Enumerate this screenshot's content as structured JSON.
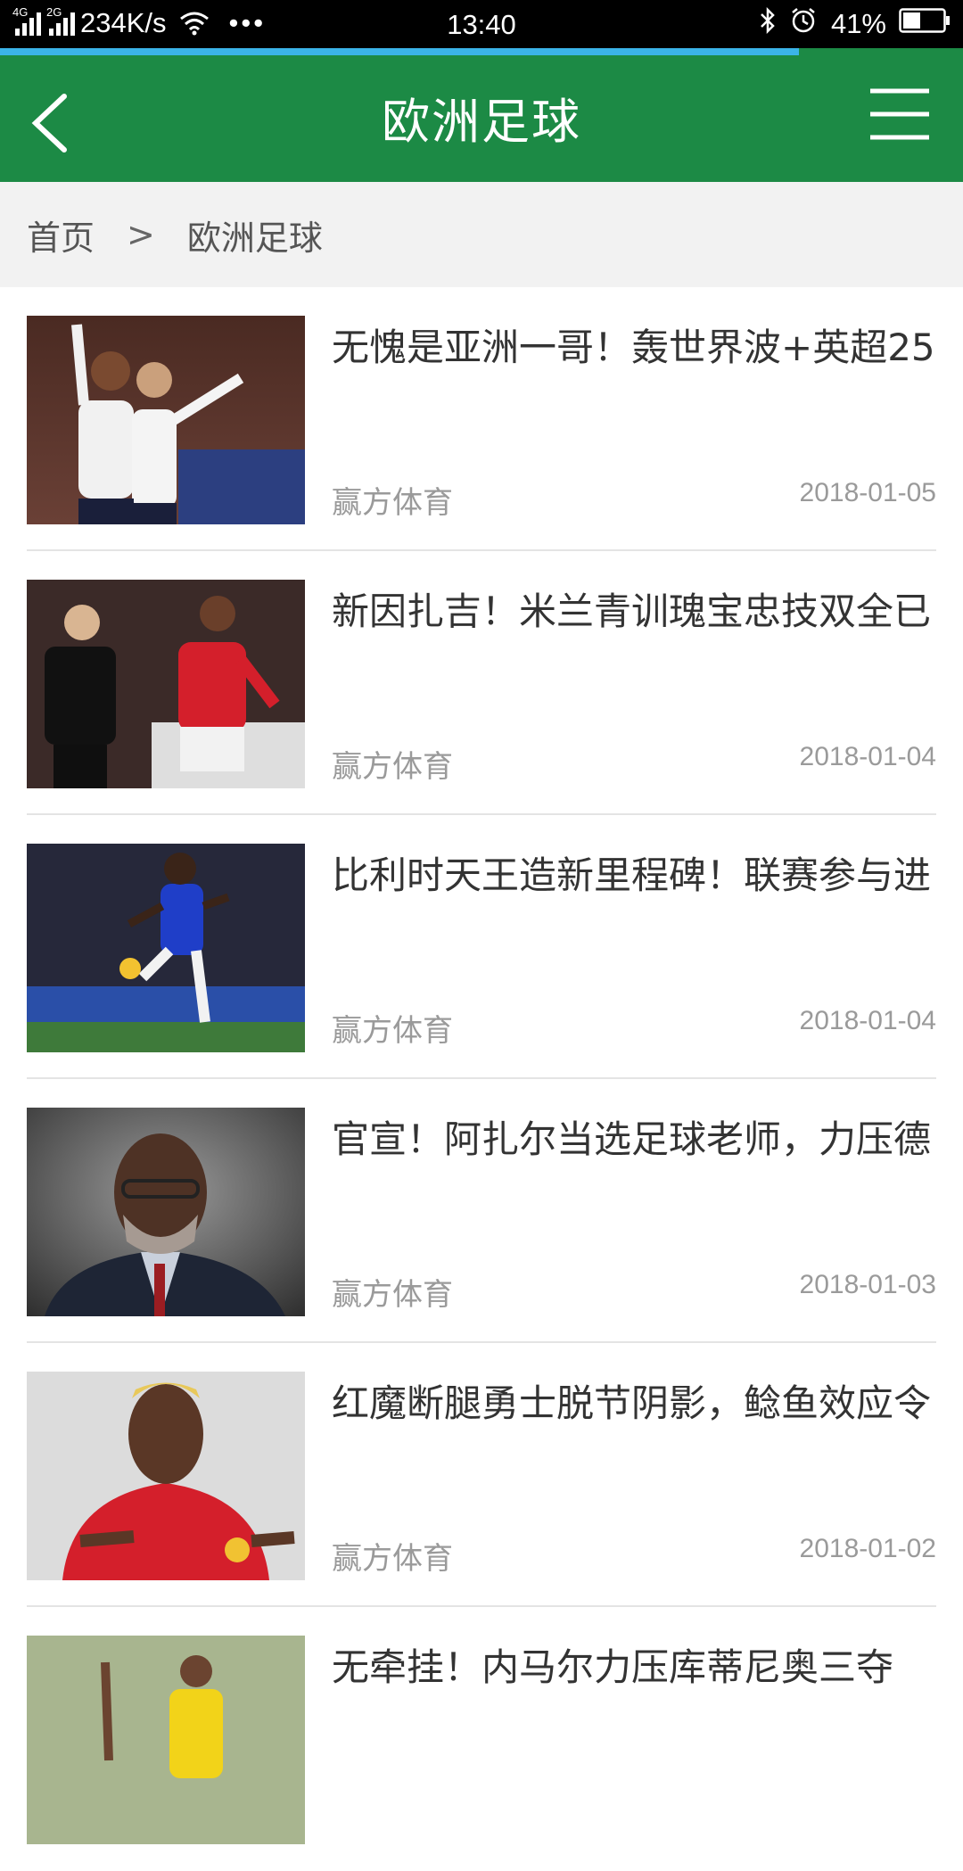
{
  "status_bar": {
    "net1": "4G",
    "net2": "2G",
    "speed": "234K/s",
    "dots": "•••",
    "time": "13:40",
    "battery": "41%",
    "load_progress": 0.83
  },
  "header": {
    "title": "欧洲足球",
    "back_icon": "chevron-left-icon",
    "menu_icon": "hamburger-menu-icon",
    "color": "#1c8a45"
  },
  "breadcrumb": {
    "home": "首页",
    "separator": ">",
    "current": "欧洲足球"
  },
  "articles": [
    {
      "title": "无愧是亚洲一哥！轰世界波+英超25",
      "source": "赢方体育",
      "date": "2018-01-05"
    },
    {
      "title": "新因扎吉！米兰青训瑰宝忠技双全已",
      "source": "赢方体育",
      "date": "2018-01-04"
    },
    {
      "title": "比利时天王造新里程碑！联赛参与进",
      "source": "赢方体育",
      "date": "2018-01-04"
    },
    {
      "title": "官宣！阿扎尔当选足球老师，力压德",
      "source": "赢方体育",
      "date": "2018-01-03"
    },
    {
      "title": "红魔断腿勇士脱节阴影，鲶鱼效应令",
      "source": "赢方体育",
      "date": "2018-01-02"
    },
    {
      "title": "无牵挂！内马尔力压库蒂尼奥三夺",
      "source": "",
      "date": ""
    }
  ]
}
